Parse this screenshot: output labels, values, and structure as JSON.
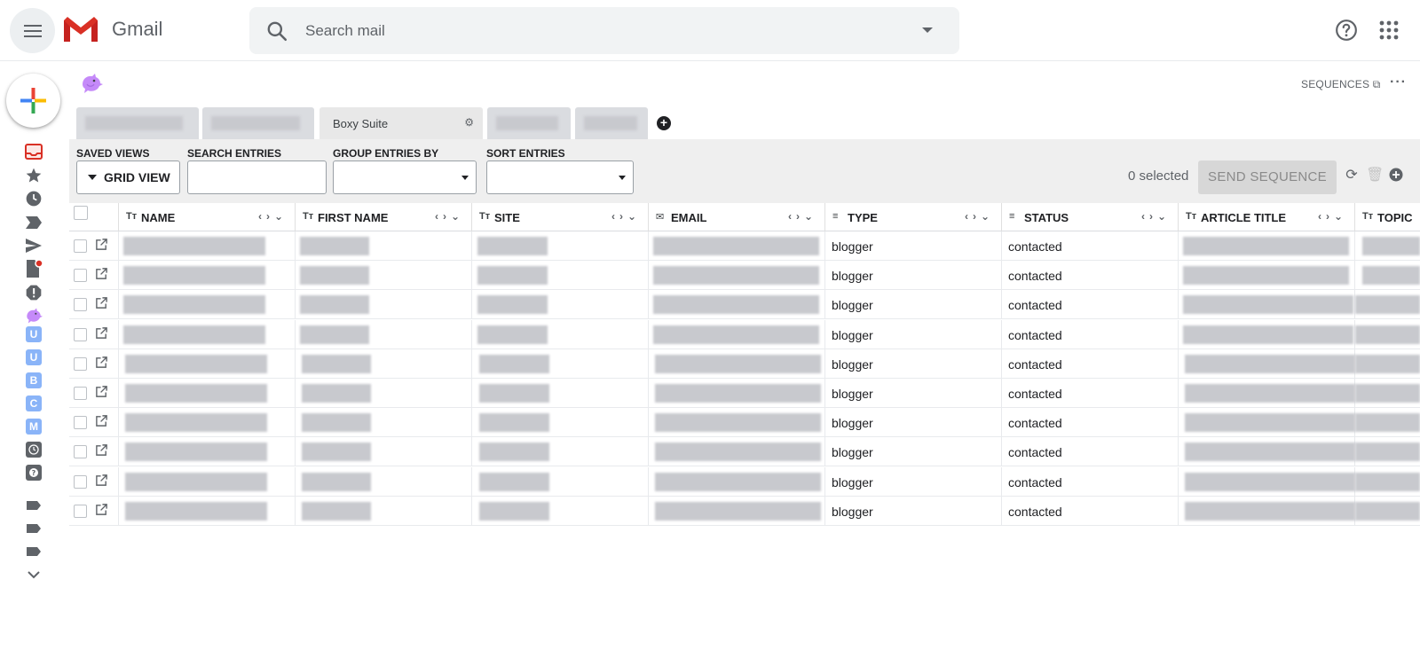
{
  "app": {
    "name": "Gmail"
  },
  "search": {
    "placeholder": "Search mail"
  },
  "header_links": {
    "sequences": "SEQUENCES"
  },
  "tabs": [
    {
      "label": ""
    },
    {
      "label": ""
    },
    {
      "label": "Boxy Suite",
      "active": true
    },
    {
      "label": ""
    },
    {
      "label": ""
    }
  ],
  "toolbar": {
    "saved_views_label": "SAVED VIEWS",
    "saved_views_value": "GRID VIEW",
    "search_entries_label": "SEARCH ENTRIES",
    "search_entries_value": "",
    "group_entries_label": "GROUP ENTRIES BY",
    "sort_entries_label": "SORT ENTRIES",
    "selected_text": "0 selected",
    "send_sequence_label": "SEND SEQUENCE"
  },
  "columns": [
    {
      "label": "NAME",
      "icon": "text-type-icon"
    },
    {
      "label": "FIRST NAME",
      "icon": "text-type-icon"
    },
    {
      "label": "SITE",
      "icon": "text-type-icon"
    },
    {
      "label": "EMAIL",
      "icon": "email-type-icon"
    },
    {
      "label": "TYPE",
      "icon": "list-type-icon"
    },
    {
      "label": "STATUS",
      "icon": "list-type-icon"
    },
    {
      "label": "ARTICLE TITLE",
      "icon": "text-type-icon"
    },
    {
      "label": "TOPIC",
      "icon": "text-type-icon"
    }
  ],
  "rows": [
    {
      "type": "blogger",
      "status": "contacted"
    },
    {
      "type": "blogger",
      "status": "contacted"
    },
    {
      "type": "blogger",
      "status": "contacted"
    },
    {
      "type": "blogger",
      "status": "contacted"
    },
    {
      "type": "blogger",
      "status": "contacted"
    },
    {
      "type": "blogger",
      "status": "contacted"
    },
    {
      "type": "blogger",
      "status": "contacted"
    },
    {
      "type": "blogger",
      "status": "contacted"
    },
    {
      "type": "blogger",
      "status": "contacted"
    },
    {
      "type": "blogger",
      "status": "contacted"
    }
  ],
  "colors": {
    "brand_red": "#d93025",
    "label_blue": "#8ab4f8",
    "bird_purple": "#c58af9",
    "redacted": "#c8c9ce"
  }
}
